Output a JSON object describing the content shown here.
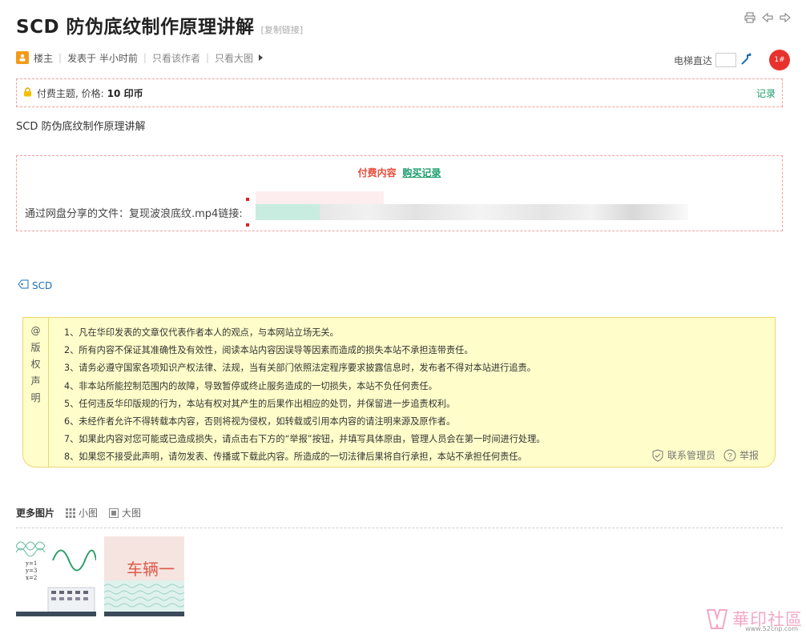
{
  "post": {
    "title": "SCD 防伪底纹制作原理讲解",
    "copy_link": "[复制链接]"
  },
  "meta": {
    "author_role": "楼主",
    "posted": "发表于 半小时前",
    "only_author": "只看该作者",
    "only_big": "只看大图",
    "elevator_label": "电梯直达",
    "floor_badge": "1#"
  },
  "paid_bar": {
    "label": "付费主题, 价格:",
    "price": "10 印币",
    "record": "记录"
  },
  "body_text": "SCD 防伪底纹制作原理讲解",
  "paid_content": {
    "header": "付费内容",
    "buy_record": "购买记录",
    "share_prefix": "通过网盘分享的文件：复现波浪底纹.mp4链接:"
  },
  "tags": [
    "SCD"
  ],
  "copyright": {
    "side_label": [
      "@",
      "版",
      "权",
      "声",
      "明"
    ],
    "lines": [
      "1、凡在华印发表的文章仅代表作者本人的观点，与本网站立场无关。",
      "2、所有内容不保证其准确性及有效性，阅读本站内容因误导等因素而造成的损失本站不承担连带责任。",
      "3、请务必遵守国家各项知识产权法律、法规，当有关部门依照法定程序要求披露信息时，发布者不得对本站进行追责。",
      "4、非本站所能控制范围内的故障，导致暂停或终止服务造成的一切损失，本站不负任何责任。",
      "5、任何违反华印版规的行为，本站有权对其产生的后果作出相应的处罚，并保留进一步追责权利。",
      "6、未经作者允许不得转载本内容，否则将视为侵权，如转载或引用本内容的请注明来源及原作者。",
      "7、如果此内容对您可能或已造成损失，请点击右下方的“举报”按钮，并填写具体原由，管理人员会在第一时间进行处理。",
      "8、如果您不接受此声明，请勿发表、传播或下载此内容。所造成的一切法律后果将自行承担，本站不承担任何责任。"
    ],
    "contact_admin": "联系管理员",
    "report": "举报"
  },
  "more_images": {
    "title": "更多图片",
    "small": "小图",
    "large": "大图",
    "thumb1_labels": [
      "y=1",
      "y=3",
      "x=2"
    ],
    "thumb2_text": "车辆一"
  },
  "watermark": {
    "text": "華印社區",
    "url": "www.52cnp.com"
  },
  "colors": {
    "accent_red": "#e74c3c",
    "accent_green": "#1a9c6a",
    "link_blue": "#1a6fb3",
    "notice_bg": "#fffeca",
    "notice_border": "#efd66a"
  }
}
